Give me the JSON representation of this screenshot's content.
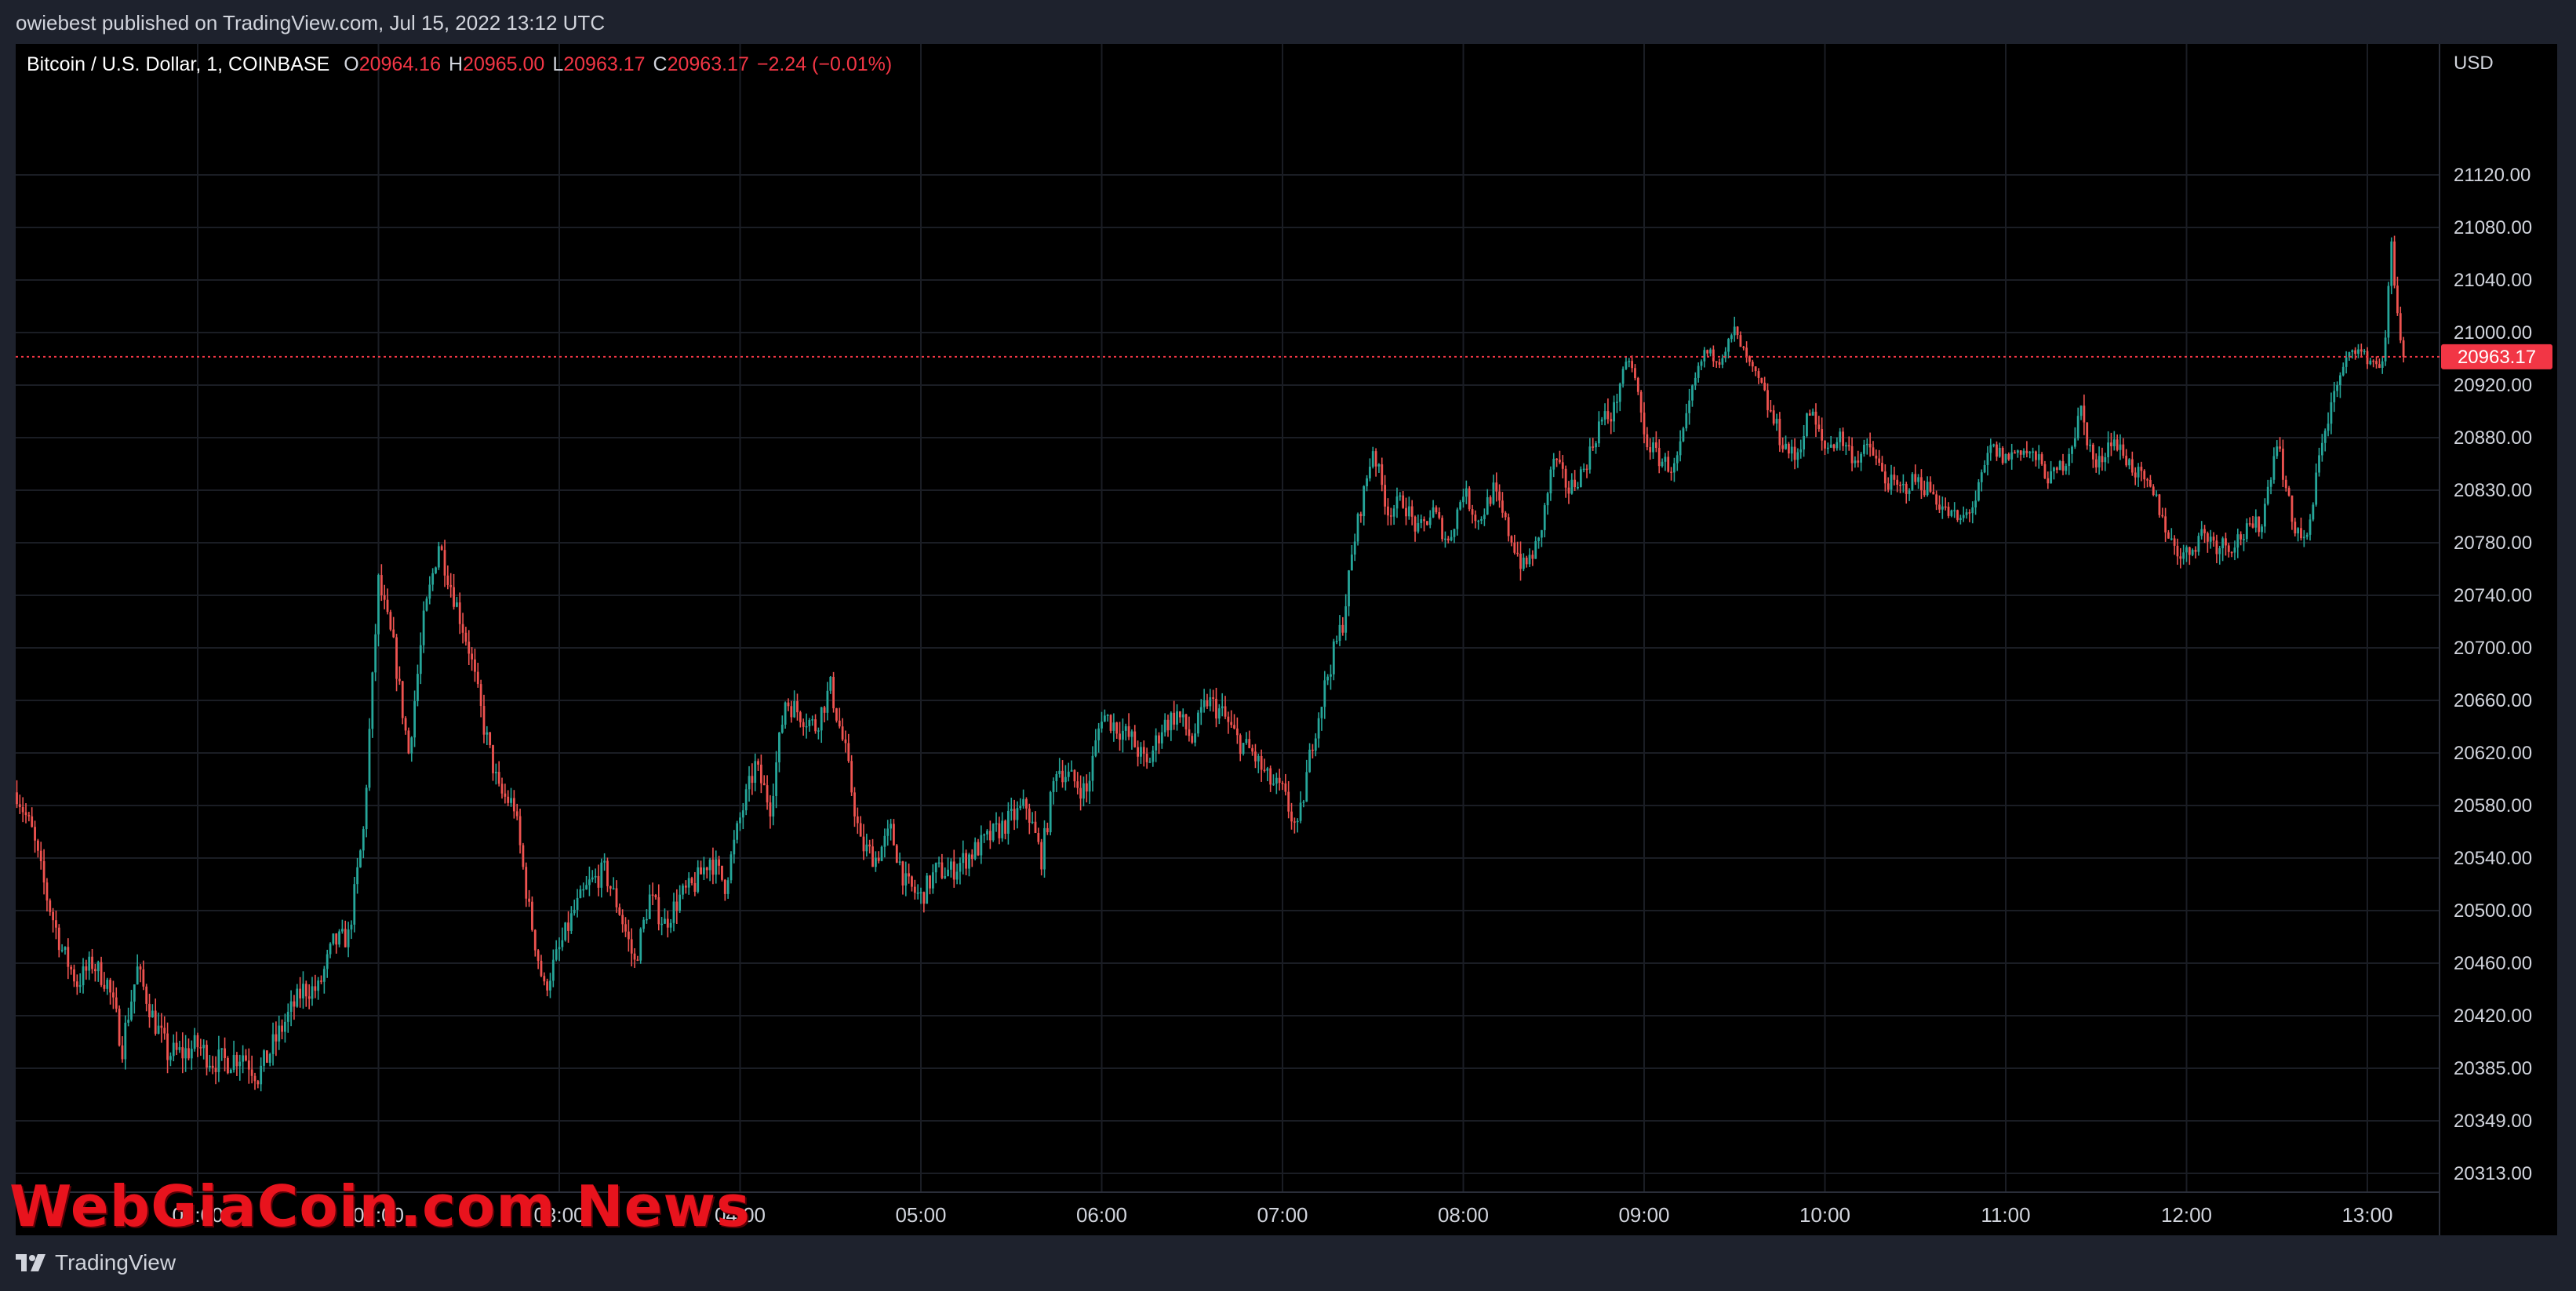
{
  "header": {
    "publisher_line": "owiebest published on TradingView.com, Jul 15, 2022 13:12 UTC"
  },
  "legend": {
    "symbol": "Bitcoin / U.S. Dollar, 1, COINBASE",
    "open_label": "O",
    "open": "20964.16",
    "high_label": "H",
    "high": "20965.00",
    "low_label": "L",
    "low": "20963.17",
    "close_label": "C",
    "close": "20963.17",
    "change": "−2.24 (−0.01%)"
  },
  "footer": {
    "brand": "TradingView"
  },
  "watermark": {
    "text": "WebGiaCoin.com News"
  },
  "colors": {
    "background": "#000000",
    "frame": "#1e222d",
    "up": "#26a69a",
    "down": "#ef5350",
    "price_line": "#f23645",
    "grid": "#1a1d24",
    "axis_text": "#d1d4dc"
  },
  "chart_data": {
    "type": "candlestick",
    "title": "Bitcoin / U.S. Dollar, 1, COINBASE",
    "currency_label": "USD",
    "interval": "1 minute",
    "x_ticks": [
      "01:00",
      "02:00",
      "03:00",
      "04:00",
      "05:00",
      "06:00",
      "07:00",
      "08:00",
      "09:00",
      "10:00",
      "11:00",
      "12:00",
      "13:00"
    ],
    "x_range": [
      "00:01",
      "13:12"
    ],
    "y_ticks": [
      20313,
      20349,
      20385,
      20420,
      20460,
      20500,
      20540,
      20580,
      20620,
      20660,
      20700,
      20740,
      20780,
      20830,
      20880,
      20920,
      21000,
      21040,
      21080,
      21120
    ],
    "y_tick_labels": [
      "20313.00",
      "20349.00",
      "20385.00",
      "20420.00",
      "20460.00",
      "20500.00",
      "20540.00",
      "20580.00",
      "20620.00",
      "20660.00",
      "20700.00",
      "20740.00",
      "20780.00",
      "20830.00",
      "20880.00",
      "20920.00",
      "21000.00",
      "21040.00",
      "21080.00",
      "21120.00"
    ],
    "last_price": 20963.17,
    "last_price_label": "20963.17",
    "grid": true,
    "price_path": [
      [
        "00:00",
        20590
      ],
      [
        "00:05",
        20560
      ],
      [
        "00:10",
        20510
      ],
      [
        "00:15",
        20470
      ],
      [
        "00:20",
        20445
      ],
      [
        "00:25",
        20460
      ],
      [
        "00:30",
        20445
      ],
      [
        "00:35",
        20400
      ],
      [
        "00:40",
        20455
      ],
      [
        "00:45",
        20420
      ],
      [
        "00:50",
        20395
      ],
      [
        "00:55",
        20395
      ],
      [
        "01:00",
        20400
      ],
      [
        "01:05",
        20390
      ],
      [
        "01:10",
        20390
      ],
      [
        "01:15",
        20395
      ],
      [
        "01:20",
        20380
      ],
      [
        "01:25",
        20400
      ],
      [
        "01:30",
        20420
      ],
      [
        "01:35",
        20440
      ],
      [
        "01:40",
        20440
      ],
      [
        "01:45",
        20475
      ],
      [
        "01:50",
        20480
      ],
      [
        "01:55",
        20560
      ],
      [
        "02:00",
        20750
      ],
      [
        "02:05",
        20700
      ],
      [
        "02:10",
        20620
      ],
      [
        "02:15",
        20720
      ],
      [
        "02:20",
        20780
      ],
      [
        "02:25",
        20740
      ],
      [
        "02:30",
        20700
      ],
      [
        "02:35",
        20640
      ],
      [
        "02:40",
        20590
      ],
      [
        "02:45",
        20580
      ],
      [
        "02:50",
        20500
      ],
      [
        "02:55",
        20440
      ],
      [
        "03:00",
        20470
      ],
      [
        "03:05",
        20500
      ],
      [
        "03:10",
        20520
      ],
      [
        "03:15",
        20530
      ],
      [
        "03:20",
        20500
      ],
      [
        "03:25",
        20460
      ],
      [
        "03:30",
        20510
      ],
      [
        "03:35",
        20490
      ],
      [
        "03:40",
        20510
      ],
      [
        "03:45",
        20520
      ],
      [
        "03:50",
        20540
      ],
      [
        "03:55",
        20520
      ],
      [
        "04:00",
        20570
      ],
      [
        "04:05",
        20610
      ],
      [
        "04:10",
        20580
      ],
      [
        "04:15",
        20660
      ],
      [
        "04:20",
        20650
      ],
      [
        "04:25",
        20640
      ],
      [
        "04:30",
        20670
      ],
      [
        "04:35",
        20620
      ],
      [
        "04:40",
        20550
      ],
      [
        "04:45",
        20540
      ],
      [
        "04:50",
        20560
      ],
      [
        "04:55",
        20520
      ],
      [
        "05:00",
        20510
      ],
      [
        "05:05",
        20530
      ],
      [
        "05:10",
        20530
      ],
      [
        "05:15",
        20540
      ],
      [
        "05:20",
        20550
      ],
      [
        "05:25",
        20560
      ],
      [
        "05:30",
        20570
      ],
      [
        "05:35",
        20580
      ],
      [
        "05:40",
        20540
      ],
      [
        "05:45",
        20610
      ],
      [
        "05:50",
        20600
      ],
      [
        "05:55",
        20590
      ],
      [
        "06:00",
        20650
      ],
      [
        "06:05",
        20640
      ],
      [
        "06:10",
        20630
      ],
      [
        "06:15",
        20610
      ],
      [
        "06:20",
        20640
      ],
      [
        "06:25",
        20650
      ],
      [
        "06:30",
        20630
      ],
      [
        "06:35",
        20660
      ],
      [
        "06:40",
        20650
      ],
      [
        "06:45",
        20630
      ],
      [
        "06:50",
        20620
      ],
      [
        "06:55",
        20600
      ],
      [
        "07:00",
        20590
      ],
      [
        "07:05",
        20560
      ],
      [
        "07:10",
        20630
      ],
      [
        "07:15",
        20680
      ],
      [
        "07:20",
        20720
      ],
      [
        "07:25",
        20800
      ],
      [
        "07:30",
        20870
      ],
      [
        "07:35",
        20810
      ],
      [
        "07:40",
        20820
      ],
      [
        "07:45",
        20790
      ],
      [
        "07:50",
        20810
      ],
      [
        "07:55",
        20780
      ],
      [
        "08:00",
        20830
      ],
      [
        "08:05",
        20800
      ],
      [
        "08:10",
        20830
      ],
      [
        "08:15",
        20790
      ],
      [
        "08:20",
        20760
      ],
      [
        "08:25",
        20780
      ],
      [
        "08:30",
        20860
      ],
      [
        "08:35",
        20830
      ],
      [
        "08:40",
        20850
      ],
      [
        "08:45",
        20890
      ],
      [
        "08:50",
        20900
      ],
      [
        "08:55",
        20960
      ],
      [
        "09:00",
        20880
      ],
      [
        "09:05",
        20860
      ],
      [
        "09:10",
        20850
      ],
      [
        "09:15",
        20900
      ],
      [
        "09:20",
        20970
      ],
      [
        "09:25",
        20960
      ],
      [
        "09:30",
        21000
      ],
      [
        "09:35",
        20950
      ],
      [
        "09:40",
        20910
      ],
      [
        "09:45",
        20880
      ],
      [
        "09:50",
        20860
      ],
      [
        "09:55",
        20900
      ],
      [
        "10:00",
        20870
      ],
      [
        "10:05",
        20880
      ],
      [
        "10:10",
        20860
      ],
      [
        "10:15",
        20870
      ],
      [
        "10:20",
        20840
      ],
      [
        "10:25",
        20830
      ],
      [
        "10:30",
        20840
      ],
      [
        "10:35",
        20830
      ],
      [
        "10:40",
        20810
      ],
      [
        "10:45",
        20800
      ],
      [
        "10:50",
        20820
      ],
      [
        "10:55",
        20870
      ],
      [
        "11:00",
        20860
      ],
      [
        "11:05",
        20870
      ],
      [
        "11:10",
        20860
      ],
      [
        "11:15",
        20840
      ],
      [
        "11:20",
        20860
      ],
      [
        "11:25",
        20900
      ],
      [
        "11:30",
        20850
      ],
      [
        "11:35",
        20880
      ],
      [
        "11:40",
        20860
      ],
      [
        "11:45",
        20840
      ],
      [
        "11:50",
        20820
      ],
      [
        "11:55",
        20780
      ],
      [
        "12:00",
        20770
      ],
      [
        "12:05",
        20790
      ],
      [
        "12:10",
        20780
      ],
      [
        "12:15",
        20780
      ],
      [
        "12:20",
        20790
      ],
      [
        "12:25",
        20800
      ],
      [
        "12:30",
        20880
      ],
      [
        "12:35",
        20800
      ],
      [
        "12:40",
        20780
      ],
      [
        "12:45",
        20880
      ],
      [
        "12:50",
        20920
      ],
      [
        "12:55",
        20980
      ],
      [
        "13:00",
        20960
      ],
      [
        "13:05",
        20950
      ],
      [
        "13:08",
        21070
      ],
      [
        "13:12",
        20963.17
      ]
    ]
  }
}
